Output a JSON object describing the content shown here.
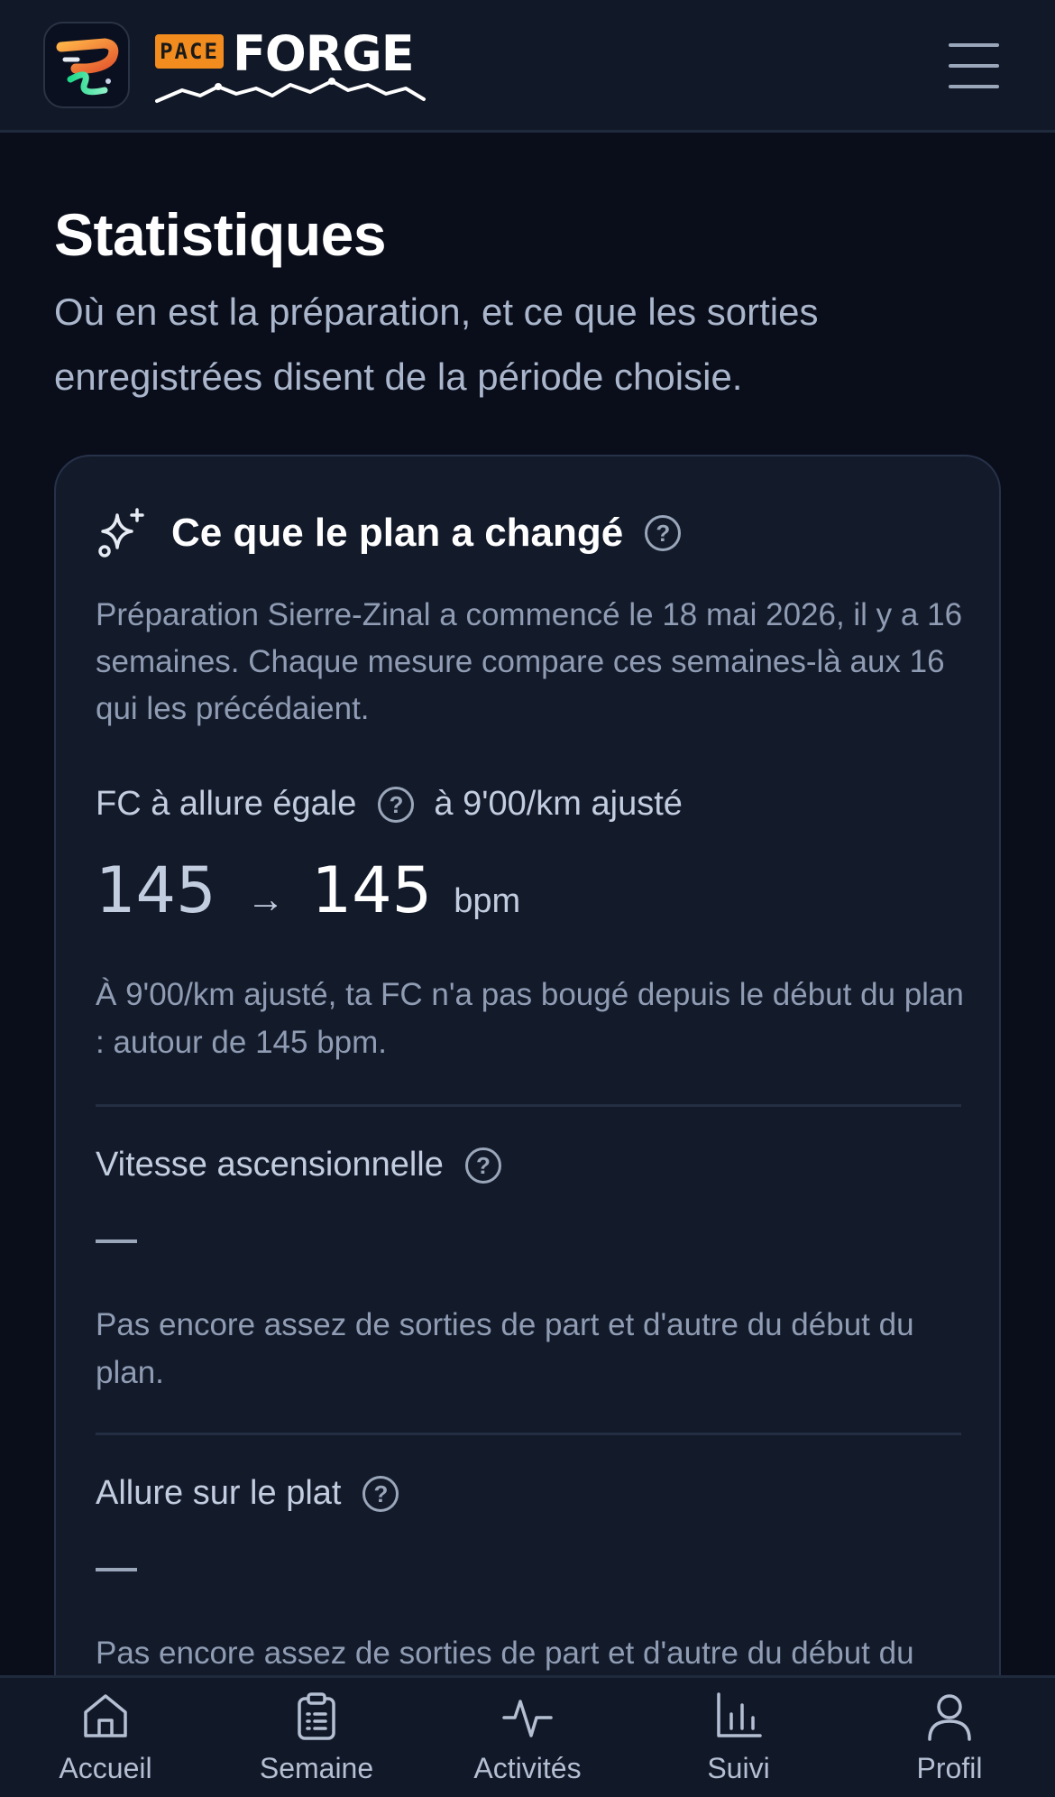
{
  "header": {
    "brand_badge": "PACE",
    "brand_name": "FORGE",
    "app_icon": "pace-forge-logo",
    "menu_icon": "hamburger-menu-icon"
  },
  "page": {
    "title": "Statistiques",
    "subtitle": "Où en est la préparation, et ce que les sorties enregistrées disent de la période choisie."
  },
  "card": {
    "title": "Ce que le plan a changé",
    "intro": "Préparation Sierre-Zinal a commencé le 18 mai 2026, il y a 16 semaines. Chaque mesure compare ces semaines-là aux 16 qui les précédaient.",
    "metrics": [
      {
        "label": "FC à allure égale",
        "context": "à 9'00/km ajusté",
        "value_before": "145",
        "arrow": "→",
        "value_after": "145",
        "unit": "bpm",
        "description": "À 9'00/km ajusté, ta FC n'a pas bougé depuis le début du plan : autour de 145 bpm."
      },
      {
        "label": "Vitesse ascensionnelle",
        "value": "—",
        "description": "Pas encore assez de sorties de part et d'autre du début du plan."
      },
      {
        "label": "Allure sur le plat",
        "value": "—",
        "description": "Pas encore assez de sorties de part et d'autre du début du plan."
      }
    ]
  },
  "nav": {
    "items": [
      {
        "label": "Accueil",
        "icon": "home-icon"
      },
      {
        "label": "Semaine",
        "icon": "clipboard-icon"
      },
      {
        "label": "Activités",
        "icon": "activity-pulse-icon"
      },
      {
        "label": "Suivi",
        "icon": "bar-chart-icon"
      },
      {
        "label": "Profil",
        "icon": "user-icon"
      }
    ]
  },
  "colors": {
    "background": "#0a0e1a",
    "card": "#131b2b",
    "accent_orange": "#f28c1e",
    "text_muted": "#8f9cb3"
  }
}
